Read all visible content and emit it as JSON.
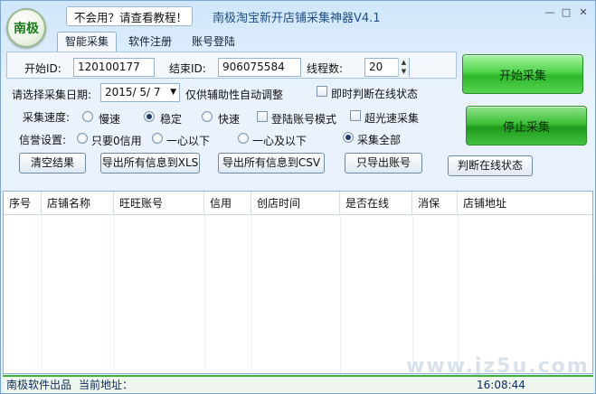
{
  "app": {
    "logo_text": "南极",
    "help_text": "不会用？请查看教程！",
    "title": "南极淘宝新开店铺采集神器V4.1"
  },
  "tabs": [
    {
      "label": "智能采集",
      "active": true
    },
    {
      "label": "软件注册",
      "active": false
    },
    {
      "label": "账号登陆",
      "active": false
    }
  ],
  "form": {
    "start_id_label": "开始ID:",
    "start_id_value": "120100177",
    "end_id_label": "结束ID:",
    "end_id_value": "906075584",
    "threads_label": "线程数:",
    "threads_value": "20",
    "date_label": "请选择采集日期:",
    "date_value": "2015/ 5/ 7",
    "date_note": "仅供辅助性自动调整",
    "realtime_check_label": "即时判断在线状态",
    "speed_label": "采集速度:",
    "speed_options": [
      "慢速",
      "稳定",
      "快速"
    ],
    "speed_selected": "稳定",
    "login_mode_label": "登陆账号模式",
    "turbo_label": "超光速采集",
    "credit_label": "信誉设置:",
    "credit_options": [
      "只要0信用",
      "一心以下",
      "一心及以下",
      "采集全部"
    ],
    "credit_selected": "采集全部"
  },
  "buttons": {
    "clear": "清空结果",
    "export_xls": "导出所有信息到XLS",
    "export_csv": "导出所有信息到CSV",
    "export_accounts": "只导出账号",
    "check_online": "判断在线状态",
    "start": "开始采集",
    "stop": "停止采集"
  },
  "table": {
    "columns": [
      "序号",
      "店铺名称",
      "旺旺账号",
      "信用",
      "创店时间",
      "是否在线",
      "消保",
      "店铺地址"
    ],
    "rows": []
  },
  "status": {
    "vendor": "南极软件出品",
    "current_url_label": "当前地址：",
    "time": "16:08:44"
  },
  "watermark": "www.jz5u.com",
  "colors": {
    "accent_green": "#3cb43c",
    "title_blue": "#1f4f84",
    "logo_green": "#1a7a1a"
  }
}
